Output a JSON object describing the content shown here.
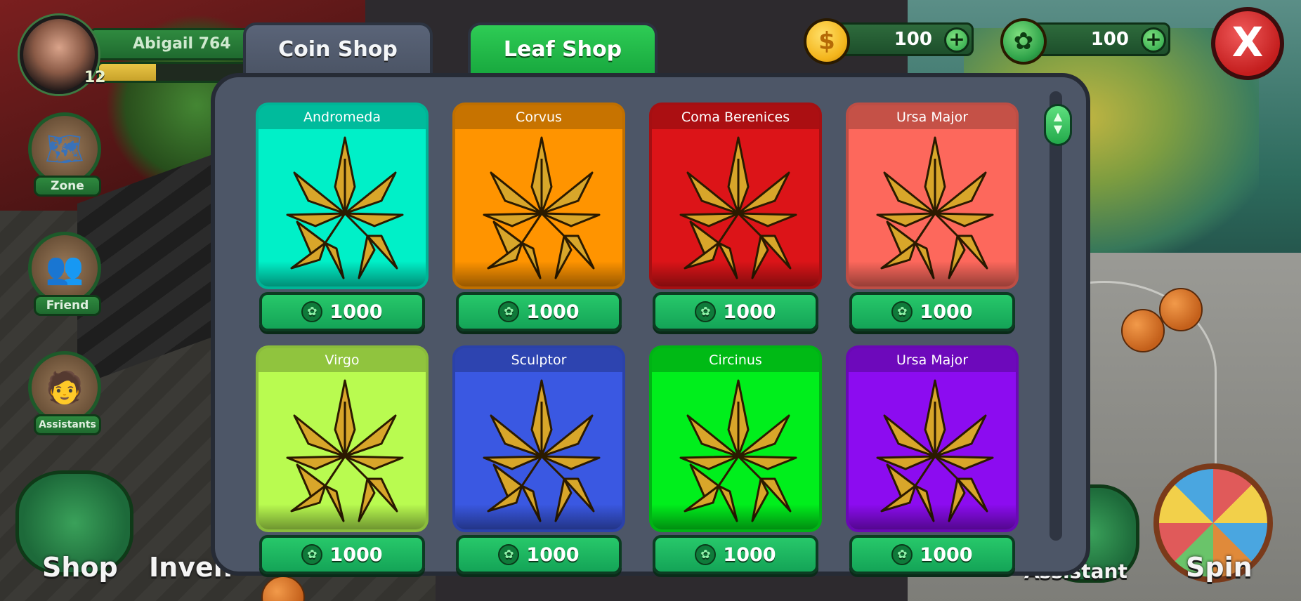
{
  "player": {
    "name": "Abigail 764",
    "level": "12",
    "xp_fraction": 0.36
  },
  "currencies": [
    {
      "name": "coins",
      "icon": "dollar-coin-icon",
      "symbol": "$",
      "value": "100",
      "plus": "+"
    },
    {
      "name": "leaves",
      "icon": "leaf-coin-icon",
      "symbol": "✿",
      "value": "100",
      "plus": "+"
    }
  ],
  "close_symbol": "X",
  "tabs": [
    {
      "label": "Coin Shop",
      "active": false
    },
    {
      "label": "Leaf Shop",
      "active": true
    }
  ],
  "left_menu": [
    {
      "label": "Zone",
      "icon": "map-icon",
      "glyph": "🗺"
    },
    {
      "label": "Friend",
      "icon": "friends-icon",
      "glyph": "👥"
    },
    {
      "label": "Assistants",
      "icon": "farmer-icon",
      "glyph": "🧑"
    }
  ],
  "bottom": {
    "shop": "Shop",
    "inventory": "Inven",
    "assistant": "Assistant",
    "spin": "Spin"
  },
  "items": [
    {
      "name": "Andromeda",
      "price": "1000",
      "color": "#00f0c8"
    },
    {
      "name": "Corvus",
      "price": "1000",
      "color": "#ff9400"
    },
    {
      "name": "Coma Berenices",
      "price": "1000",
      "color": "#dc1418"
    },
    {
      "name": "Ursa Major",
      "price": "1000",
      "color": "#fd685c"
    },
    {
      "name": "Virgo",
      "price": "1000",
      "color": "#b9fb50"
    },
    {
      "name": "Sculptor",
      "price": "1000",
      "color": "#3a58e2"
    },
    {
      "name": "Circinus",
      "price": "1000",
      "color": "#00ef1c"
    },
    {
      "name": "Ursa Major",
      "price": "1000",
      "color": "#8c0cf0"
    }
  ]
}
